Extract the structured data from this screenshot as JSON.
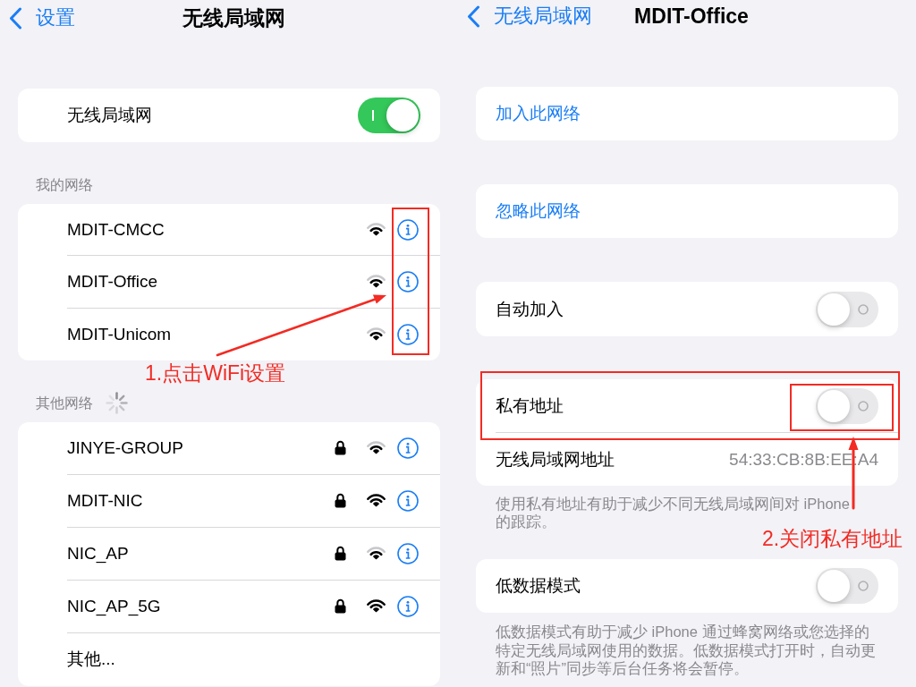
{
  "wifi_screen": {
    "nav_bar": {
      "back_label": "设置",
      "title": "无线局域网"
    },
    "wifi_toggle": {
      "label": "无线局域网",
      "on": true
    },
    "my_networks": {
      "header": "我的网络",
      "networks": [
        {
          "name": "MDIT-CMCC",
          "locked": false,
          "full_signal": false
        },
        {
          "name": "MDIT-Office",
          "locked": false,
          "full_signal": false
        },
        {
          "name": "MDIT-Unicom",
          "locked": false,
          "full_signal": false
        }
      ]
    },
    "other_networks": {
      "header": "其他网络",
      "loading": true,
      "networks": [
        {
          "name": "JINYE-GROUP",
          "locked": true,
          "full_signal": false
        },
        {
          "name": "MDIT-NIC",
          "locked": true,
          "full_signal": true
        },
        {
          "name": "NIC_AP",
          "locked": true,
          "full_signal": false
        },
        {
          "name": "NIC_AP_5G",
          "locked": true,
          "full_signal": true
        }
      ],
      "other_label": "其他..."
    }
  },
  "detail_screen": {
    "nav_bar": {
      "back_label": "无线局域网",
      "title": "MDIT-Office"
    },
    "actions": [
      {
        "label": "加入此网络"
      },
      {
        "label": "忽略此网络"
      }
    ],
    "auto_join": {
      "label": "自动加入",
      "on": false
    },
    "private_address": {
      "label": "私有地址",
      "on": false
    },
    "wifi_address": {
      "label": "无线局域网地址",
      "value": "54:33:CB:8B:EE:A4"
    },
    "private_address_note": "使用私有地址有助于减少不同无线局域网间对 iPhone 的跟踪。",
    "low_data_mode": {
      "label": "低数据模式",
      "on": false
    },
    "low_data_note": "低数据模式有助于减少 iPhone 通过蜂窝网络或您选择的特定无线局域网使用的数据。低数据模式打开时，自动更新和“照片”同步等后台任务将会暂停。"
  },
  "annotations": [
    {
      "text": "1.点击WiFi设置"
    },
    {
      "text": "2.关闭私有地址"
    }
  ]
}
